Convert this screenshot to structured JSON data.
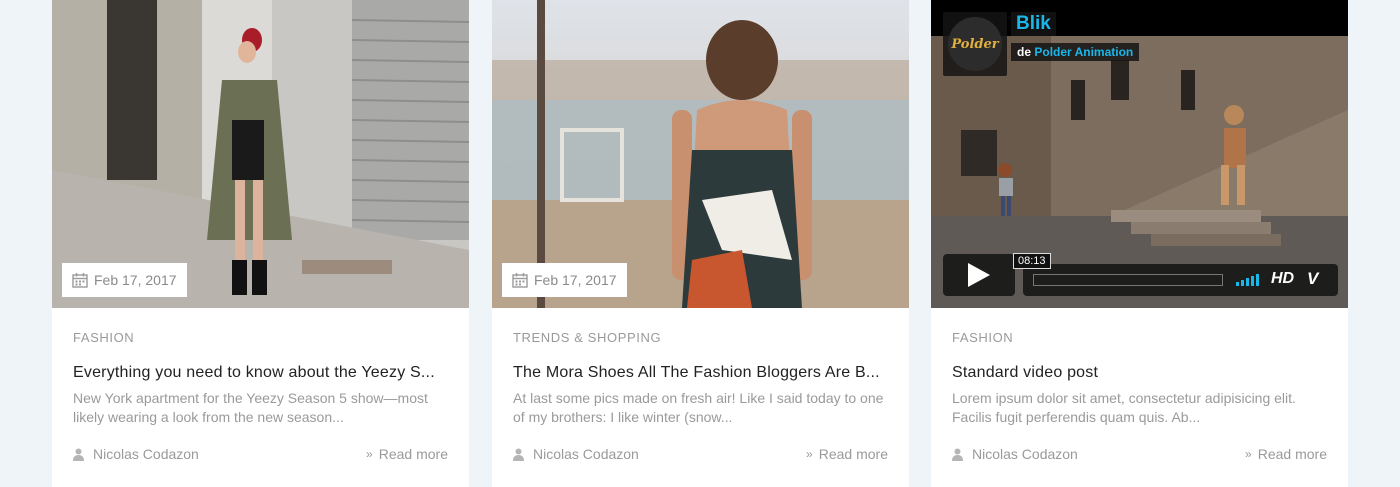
{
  "posts": [
    {
      "date": "Feb 17, 2017",
      "category": "FASHION",
      "title": "Everything you need to know about the Yeezy S...",
      "excerpt": "New York apartment for the Yeezy Season 5 show—most likely wearing a look from the new season...",
      "author": "Nicolas Codazon",
      "read_more": "Read more"
    },
    {
      "date": "Feb 17, 2017",
      "category": "TRENDS & SHOPPING",
      "title": "The Mora Shoes All The Fashion Bloggers Are B...",
      "excerpt": "At last some pics made on fresh air! Like I said today to one of my brothers: I like winter (snow...",
      "author": "Nicolas Codazon",
      "read_more": "Read more"
    },
    {
      "category": "FASHION",
      "title": "Standard video post",
      "excerpt": "Lorem ipsum dolor sit amet, consectetur adipisicing elit. Facilis fugit perferendis quam quis. Ab...",
      "author": "Nicolas Codazon",
      "read_more": "Read more",
      "video": {
        "title": "Blik",
        "by_prefix": "de",
        "channel": "Polder Animation",
        "logo_text": "Polder",
        "time": "08:13",
        "hd": "HD",
        "vimeo": "V",
        "accent": "#1ab7ea"
      }
    }
  ],
  "icons": {
    "calendar": "calendar-icon",
    "user": "user-icon",
    "read_more": "double-chevron-right-icon",
    "play": "play-icon"
  }
}
